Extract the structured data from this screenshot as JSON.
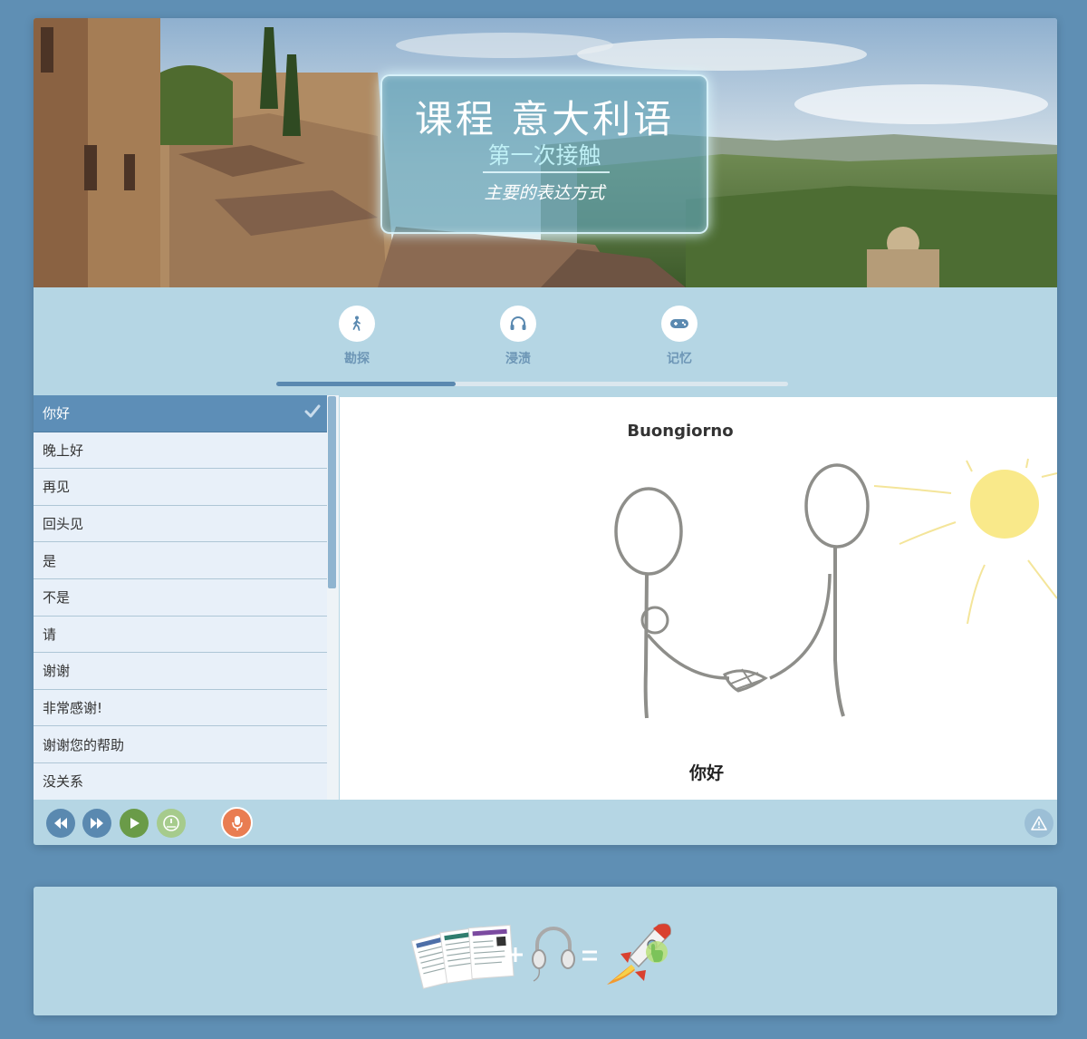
{
  "banner": {
    "title": "课程 意大利语",
    "subtitle": "第一次接触",
    "description": "主要的表达方式"
  },
  "tabs": [
    {
      "label": "勘探",
      "icon": "walking-person-icon"
    },
    {
      "label": "浸渍",
      "icon": "headphones-icon"
    },
    {
      "label": "记忆",
      "icon": "gamepad-icon"
    }
  ],
  "progress": {
    "fraction": 0.35
  },
  "phrases": [
    {
      "label": "你好",
      "active": true,
      "done": true
    },
    {
      "label": "晚上好"
    },
    {
      "label": "再见"
    },
    {
      "label": "回头见"
    },
    {
      "label": "是"
    },
    {
      "label": "不是"
    },
    {
      "label": "请"
    },
    {
      "label": "谢谢"
    },
    {
      "label": "非常感谢!"
    },
    {
      "label": "谢谢您的帮助"
    },
    {
      "label": "没关系"
    }
  ],
  "card": {
    "word": "Buongiorno",
    "translation": "你好"
  },
  "controls": {
    "icons": [
      "rewind-icon",
      "fast-forward-icon",
      "play-icon",
      "speed-icon",
      "microphone-icon",
      "warning-icon"
    ]
  },
  "colors": {
    "background": "#5f8fb4",
    "panel": "#b5d6e4",
    "accent": "#5a89b0",
    "play": "#6a9b48",
    "mic": "#e97d52",
    "sun": "#f9e98a"
  }
}
